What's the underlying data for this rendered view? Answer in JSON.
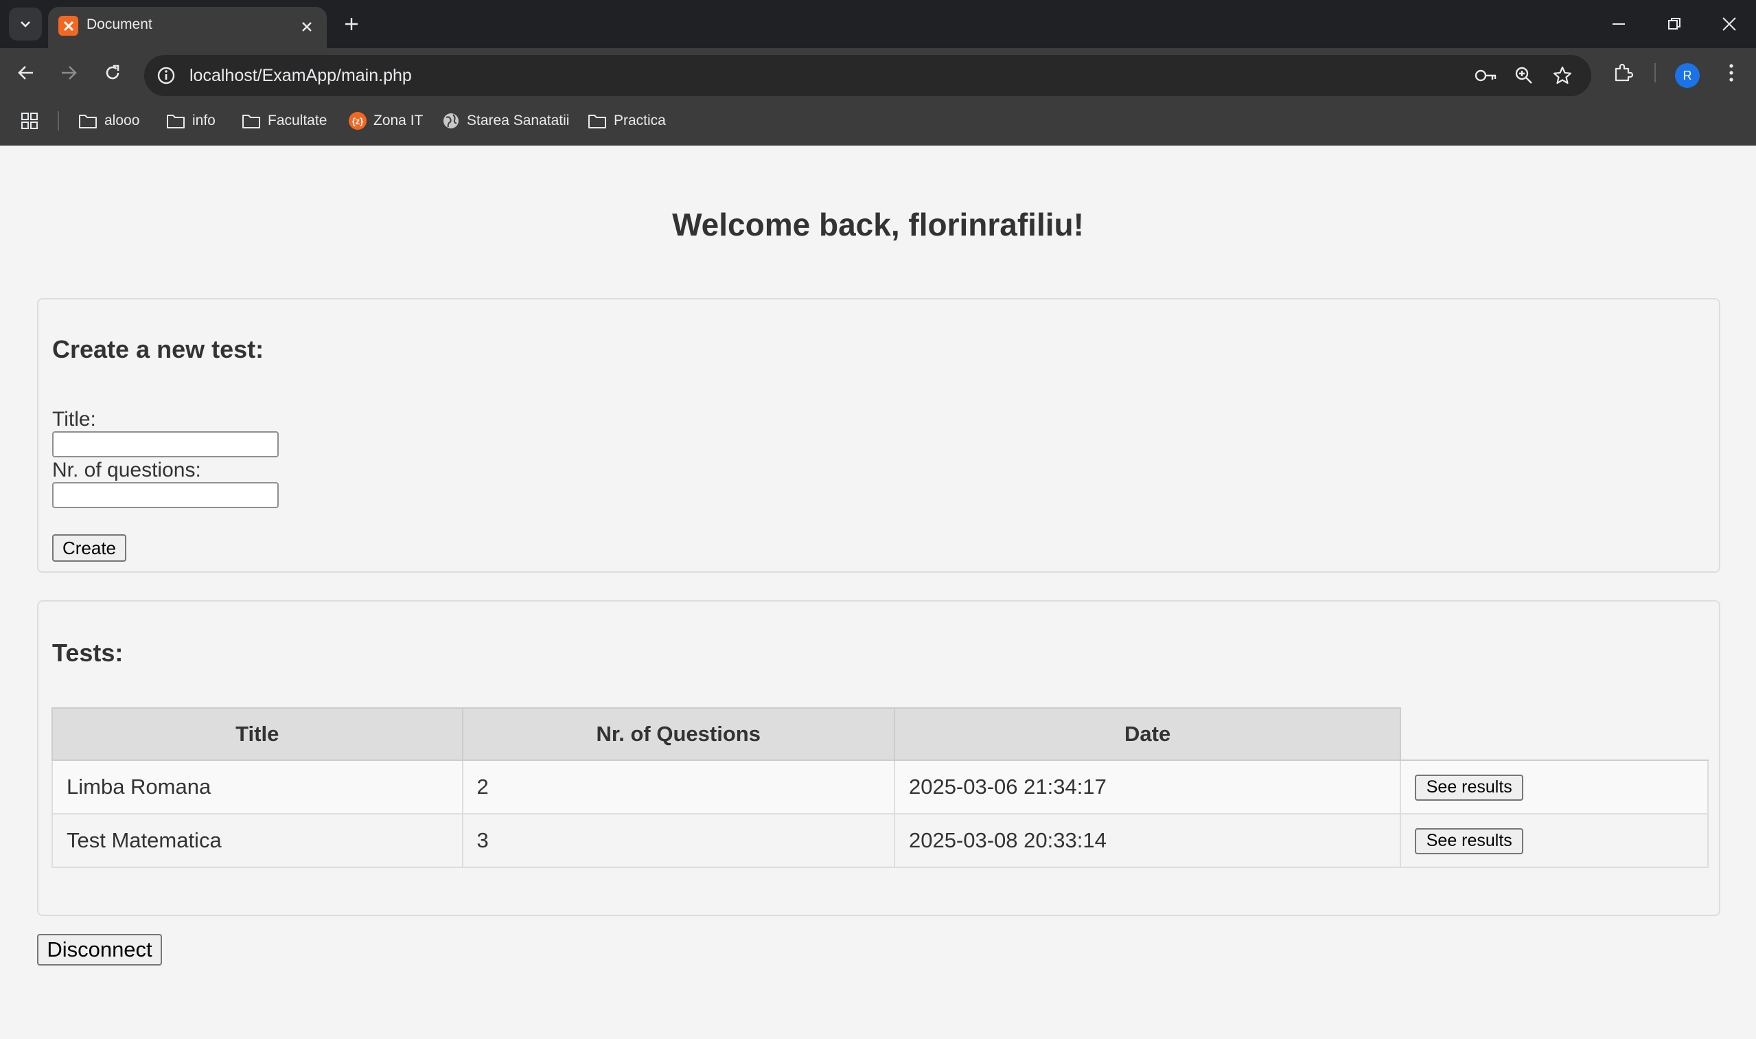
{
  "browser": {
    "tab_title": "Document",
    "url": "localhost/ExamApp/main.php",
    "avatar_letter": "R",
    "bookmarks": [
      {
        "label": "alooo",
        "icon": "folder-icon"
      },
      {
        "label": "info",
        "icon": "folder-icon"
      },
      {
        "label": "Facultate",
        "icon": "folder-icon"
      },
      {
        "label": "Zona IT",
        "icon": "zona-it-favicon"
      },
      {
        "label": "Starea Sanatatii",
        "icon": "globe-icon"
      },
      {
        "label": "Practica",
        "icon": "folder-icon"
      }
    ]
  },
  "page": {
    "welcome": "Welcome back, florinrafiliu!",
    "create": {
      "heading": "Create a new test:",
      "title_label": "Title:",
      "title_value": "",
      "questions_label": "Nr. of questions:",
      "questions_value": "",
      "submit_label": "Create"
    },
    "tests": {
      "heading": "Tests:",
      "columns": [
        "Title",
        "Nr. of Questions",
        "Date"
      ],
      "rows": [
        {
          "title": "Limba Romana",
          "questions": "2",
          "date": "2025-03-06 21:34:17",
          "action": "See results"
        },
        {
          "title": "Test Matematica",
          "questions": "3",
          "date": "2025-03-08 20:33:14",
          "action": "See results"
        }
      ]
    },
    "disconnect_label": "Disconnect"
  },
  "colors": {
    "chrome_dark": "#202124",
    "chrome_toolbar": "#3c3c3c",
    "page_bg": "#f4f4f4",
    "table_header": "#dddddd",
    "favicon_orange": "#f26822",
    "avatar_blue": "#1a73e8"
  }
}
